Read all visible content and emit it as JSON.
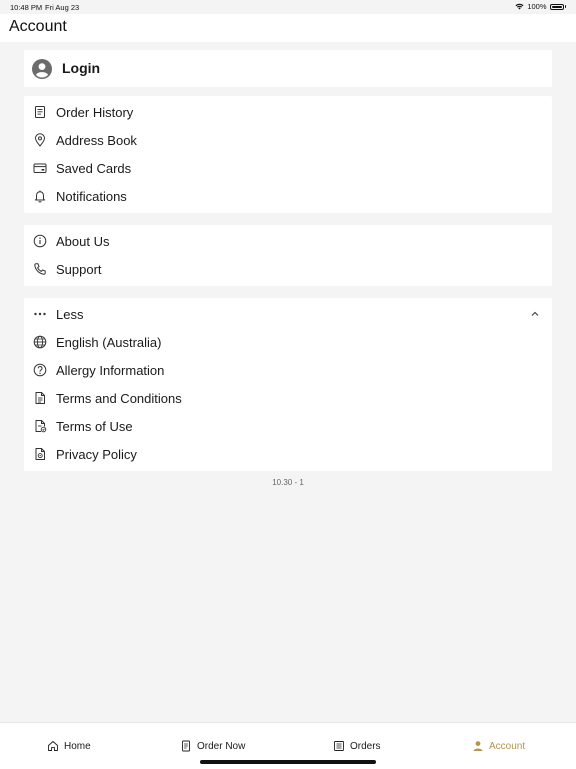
{
  "status_bar": {
    "time": "10:48 PM",
    "date": "Fri Aug 23",
    "battery": "100%"
  },
  "header": {
    "title": "Account"
  },
  "login": {
    "label": "Login"
  },
  "group1": [
    {
      "label": "Order History",
      "icon": "receipt-icon"
    },
    {
      "label": "Address Book",
      "icon": "location-pin-icon"
    },
    {
      "label": "Saved Cards",
      "icon": "credit-card-icon"
    },
    {
      "label": "Notifications",
      "icon": "bell-icon"
    }
  ],
  "group2": [
    {
      "label": "About Us",
      "icon": "info-icon"
    },
    {
      "label": "Support",
      "icon": "phone-icon"
    }
  ],
  "group3": [
    {
      "label": "Less",
      "icon": "ellipsis-icon"
    },
    {
      "label": "English (Australia)",
      "icon": "globe-icon"
    },
    {
      "label": "Allergy Information",
      "icon": "question-circle-icon"
    },
    {
      "label": "Terms and Conditions",
      "icon": "document-icon"
    },
    {
      "label": "Terms of Use",
      "icon": "document-check-icon"
    },
    {
      "label": "Privacy Policy",
      "icon": "privacy-document-icon"
    }
  ],
  "version": "10.30 - 1",
  "tabbar": {
    "home": "Home",
    "order_now": "Order Now",
    "orders": "Orders",
    "account": "Account",
    "accent": "#b3964e"
  }
}
